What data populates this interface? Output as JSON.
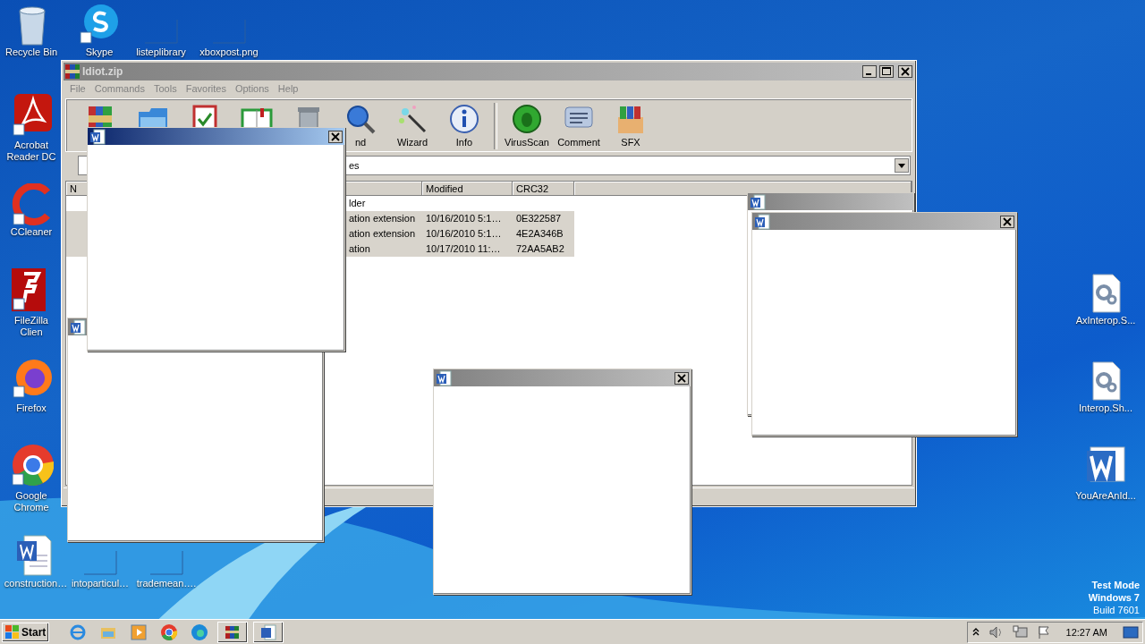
{
  "desktop_icons": [
    {
      "kind": "recycle",
      "label": "Recycle Bin"
    },
    {
      "kind": "skype",
      "label": "Skype"
    },
    {
      "kind": "blank",
      "label": "listeplibrary"
    },
    {
      "kind": "blank",
      "label": "xboxpost.png"
    },
    {
      "kind": "acrobat",
      "label": "Acrobat Reader DC"
    },
    {
      "kind": "ccleaner",
      "label": "CCleaner"
    },
    {
      "kind": "filezilla",
      "label": "FileZilla Clien"
    },
    {
      "kind": "firefox",
      "label": "Firefox"
    },
    {
      "kind": "chrome",
      "label": "Google Chrome"
    },
    {
      "kind": "worddoc",
      "label": "construction…"
    },
    {
      "kind": "blank",
      "label": "intoparticul…"
    },
    {
      "kind": "blank",
      "label": "trademean…."
    },
    {
      "kind": "gear",
      "label": "AxInterop.S..."
    },
    {
      "kind": "gear",
      "label": "Interop.Sh..."
    },
    {
      "kind": "word",
      "label": "YouAreAnId..."
    }
  ],
  "archive_window": {
    "title": "Idiot.zip",
    "menu": [
      "File",
      "Commands",
      "Tools",
      "Favorites",
      "Options",
      "Help"
    ],
    "toolbar": [
      {
        "kind": "add"
      },
      {
        "kind": "folder"
      },
      {
        "kind": "test"
      },
      {
        "kind": "book"
      },
      {
        "kind": "trash"
      },
      {
        "kind": "find",
        "label": "nd"
      },
      {
        "kind": "wand",
        "label": "Wizard"
      },
      {
        "kind": "info",
        "label": "Info"
      },
      {
        "kind": "virus",
        "label": "VirusScan"
      },
      {
        "kind": "comment",
        "label": "Comment"
      },
      {
        "kind": "sfx",
        "label": "SFX"
      }
    ],
    "path": "es",
    "columns": [
      "N",
      "Modified",
      "CRC32"
    ],
    "rows": [
      {
        "type": "lder",
        "selected": false
      },
      {
        "type": "ation extension",
        "modified": "10/16/2010 5:1…",
        "crc": "0E322587",
        "selected": true
      },
      {
        "type": "ation extension",
        "modified": "10/16/2010 5:1…",
        "crc": "4E2A346B",
        "selected": true
      },
      {
        "type": "ation",
        "modified": "10/17/2010 11:…",
        "crc": "72AA5AB2",
        "selected": true
      }
    ]
  },
  "popups": [
    {
      "active": false,
      "close": false
    },
    {
      "active": true,
      "close": true
    },
    {
      "active": false,
      "close": true
    },
    {
      "active": false,
      "close": false
    },
    {
      "active": false,
      "close": true
    }
  ],
  "watermark": [
    "Test Mode",
    "Windows 7",
    "Build 7601"
  ],
  "taskbar": {
    "start": "Start",
    "items": [
      {
        "kind": "ie",
        "running": false
      },
      {
        "kind": "explorer",
        "running": false
      },
      {
        "kind": "media",
        "running": false
      },
      {
        "kind": "chrome",
        "running": false
      },
      {
        "kind": "edge",
        "running": false
      },
      {
        "kind": "winrar",
        "running": true
      },
      {
        "kind": "word",
        "running": true
      }
    ],
    "clock": "12:27 AM"
  }
}
